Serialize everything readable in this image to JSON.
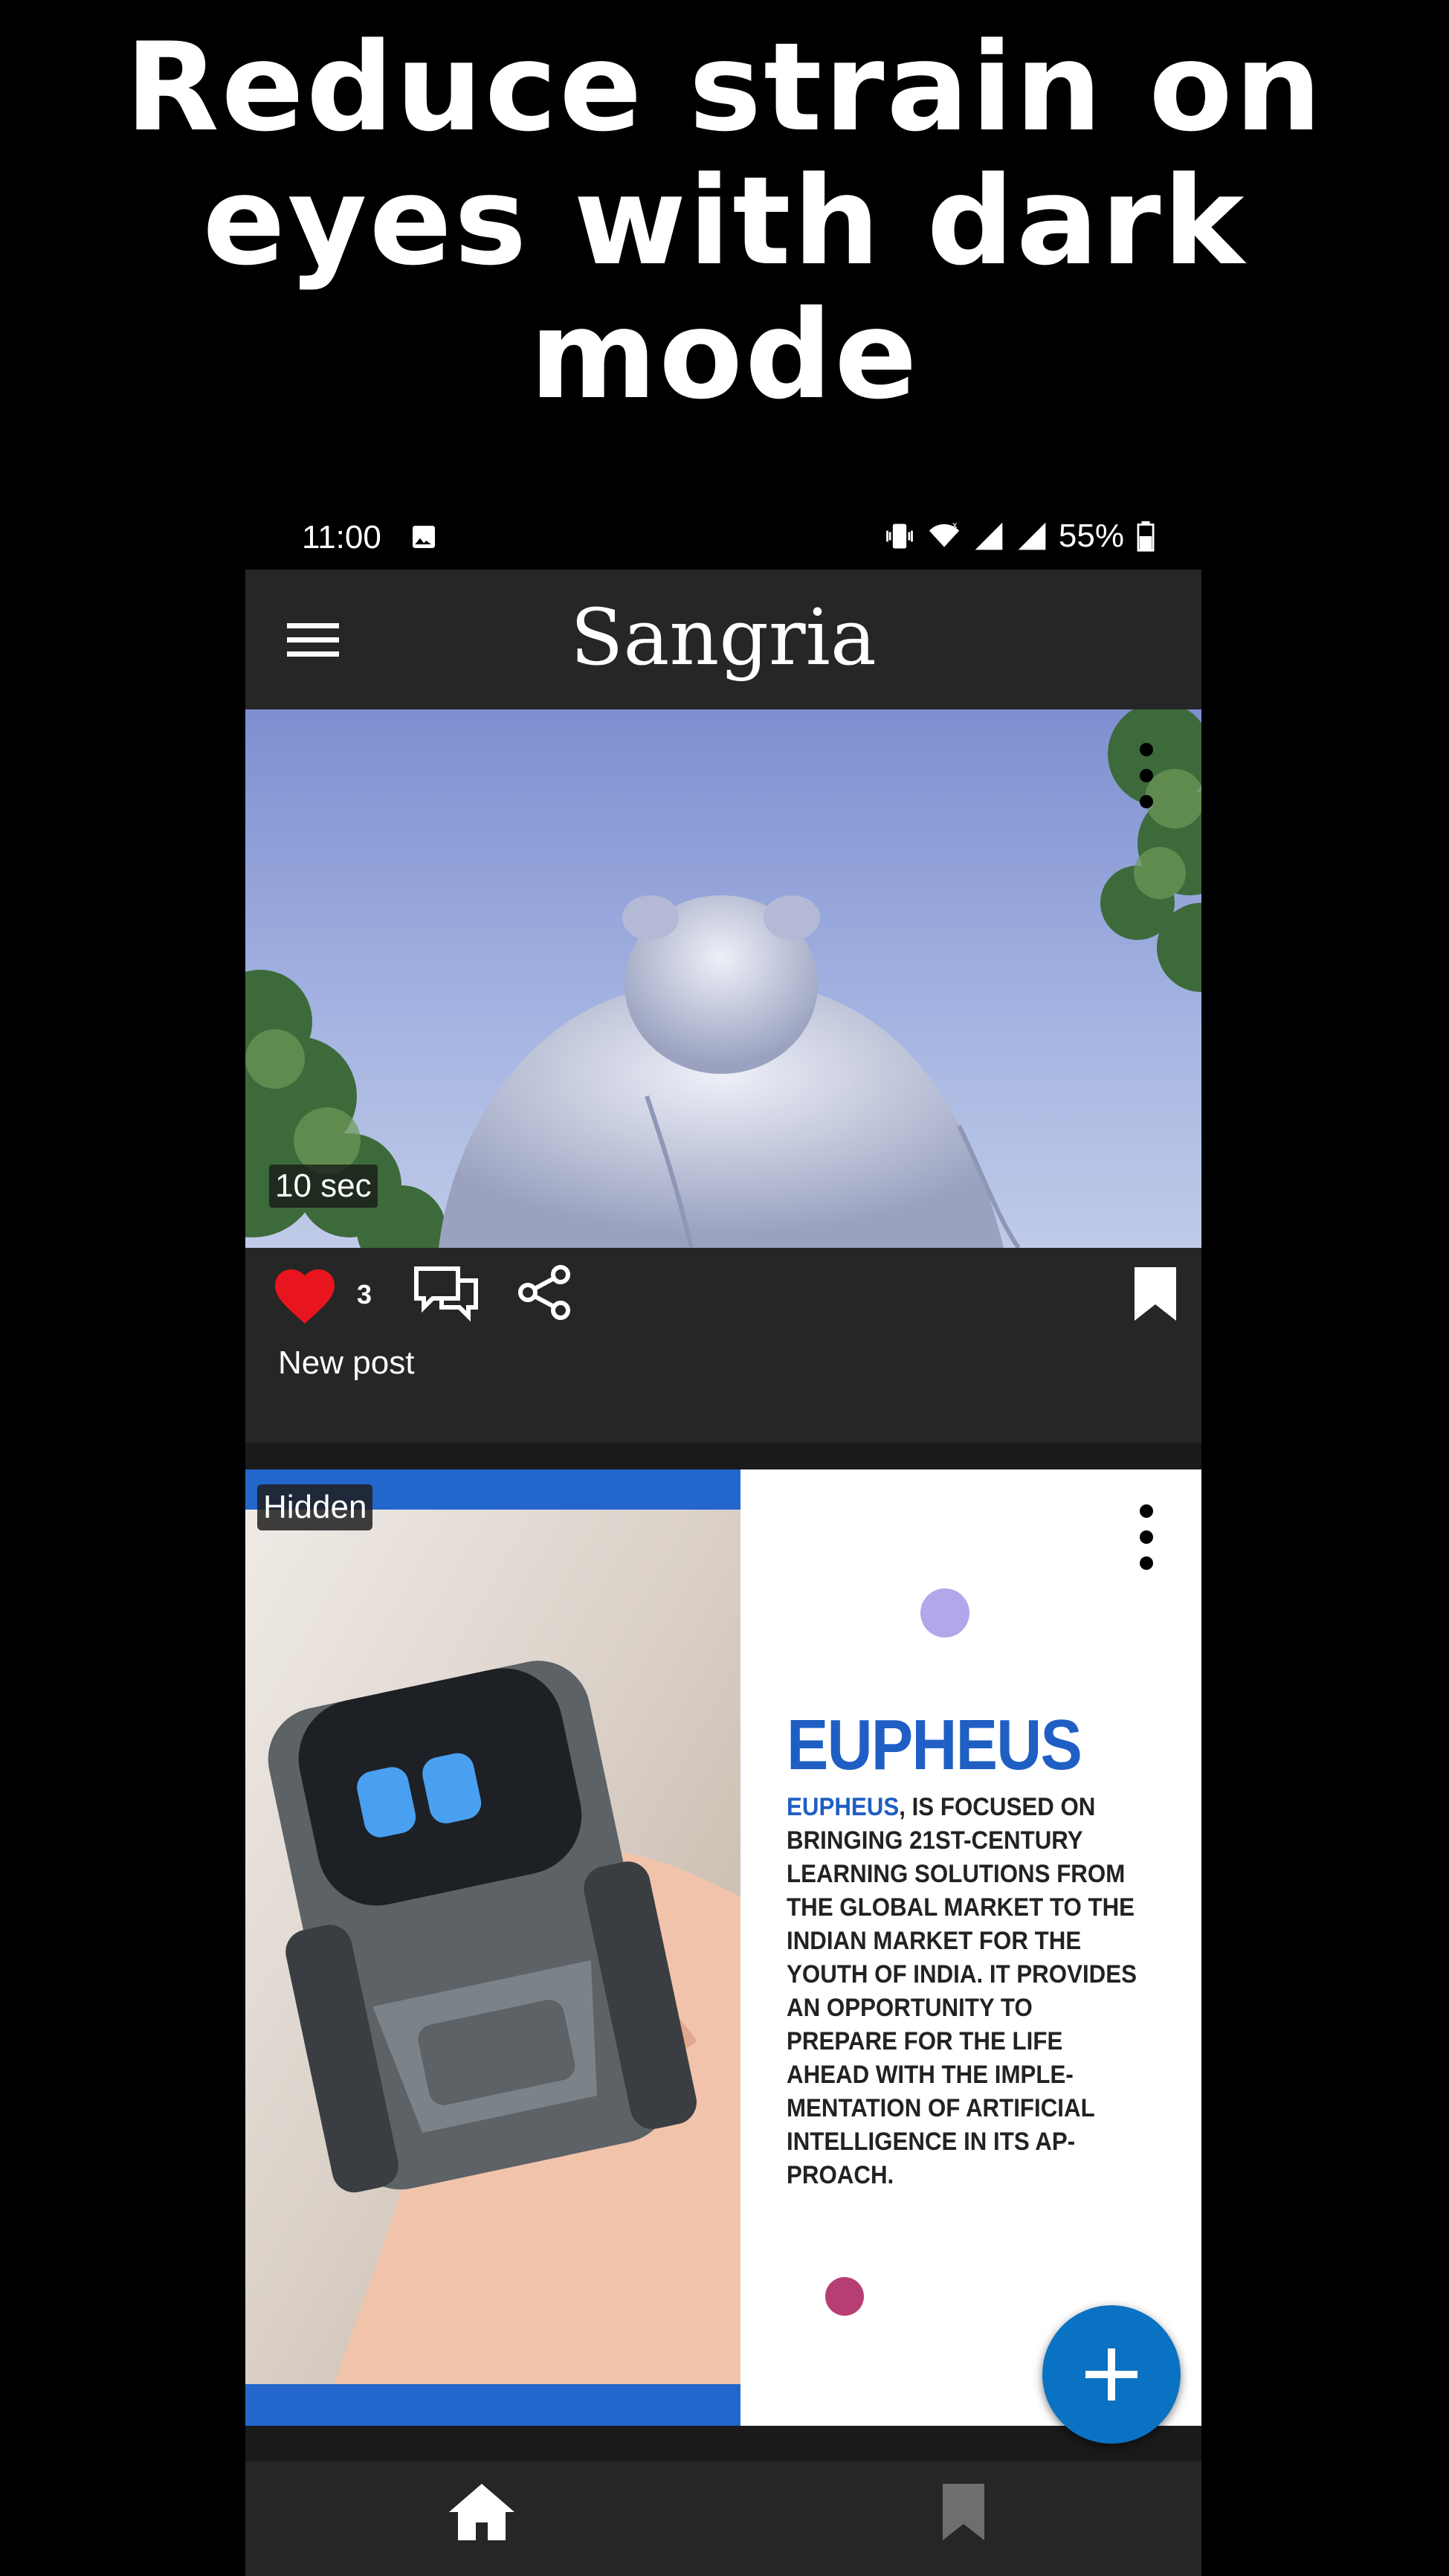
{
  "headline": "Reduce strain on eyes with dark mode",
  "status_bar": {
    "time": "11:00",
    "battery": "55%"
  },
  "app": {
    "title": "Sangria"
  },
  "posts": [
    {
      "duration": "10 sec",
      "like_count": "3",
      "caption": "New post"
    },
    {
      "badge": "Hidden",
      "ad": {
        "title": "EUPHEUS",
        "brand": "EUPHEUS",
        "body": ", IS FOCUSED ON BRINGING 21ST-CENTURY LEARNING SOLUTIONS FROM THE GLOBAL MARKET TO THE INDIAN MARKET FOR THE YOUTH OF INDIA. IT PROVIDES AN OPPORTUNITY TO PREPARE FOR THE LIFE AHEAD WITH THE IMPLE-MENTATION OF ARTIFICIAL INTELLIGENCE IN ITS AP-PROACH."
      }
    }
  ],
  "colors": {
    "accent": "#0a72c2",
    "like": "#e8141e",
    "brand_blue": "#1f5fc4",
    "background": "#000000"
  },
  "icons": [
    "menu-icon",
    "more-vert-icon",
    "heart-icon",
    "comment-icon",
    "share-icon",
    "bookmark-icon",
    "add-icon",
    "home-icon"
  ]
}
